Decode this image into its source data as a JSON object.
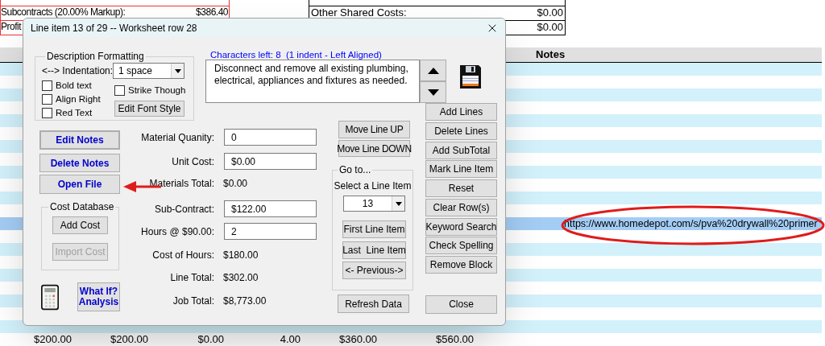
{
  "sheet": {
    "summary_left": [
      {
        "label": "Subcontracts (20.00% Markup):",
        "value": "$386.40"
      },
      {
        "label": "Profit"
      }
    ],
    "summary_right": [
      {
        "label": "Other Shared Costs:",
        "value": "$0.00"
      },
      {
        "value": "$0.00"
      }
    ],
    "notes_header": "Notes",
    "rows": [
      {
        "selected": false
      },
      {
        "selected": false
      },
      {
        "selected": false
      },
      {
        "selected": false
      },
      {
        "selected": false
      },
      {
        "selected": false
      },
      {
        "selected": false
      },
      {
        "selected": false
      },
      {
        "selected": false
      },
      {
        "selected": false
      },
      {
        "selected": false
      },
      {
        "selected": false
      },
      {
        "selected": true,
        "notes": "https://www.homedepot.com/s/pva%20drywall%20primer"
      },
      {
        "selected": false
      },
      {
        "selected": false
      },
      {
        "selected": false
      },
      {
        "selected": false
      },
      {
        "selected": false
      },
      {
        "selected": false
      },
      {
        "selected": false
      },
      {
        "selected": false
      },
      {
        "selected": false,
        "cells": [
          "$200.00",
          "$200.00",
          "$0.00",
          "4.00",
          "$360.00",
          "$560.00"
        ]
      }
    ]
  },
  "dialog": {
    "title": "Line item 13 of 29 -- Worksheet row 28",
    "characters_left": "Characters left: 8  (1 indent - Left Aligned)",
    "description": "Disconnect and remove all existing plumbing, electrical, appliances and fixtures as needed.",
    "formatting": {
      "title": "Description Formatting",
      "indentation_label": "<--> Indentation:",
      "indentation": "1 space",
      "options": [
        {
          "label": "Bold text",
          "checked": false
        },
        {
          "label": "Align Right",
          "checked": false
        },
        {
          "label": "Red Text",
          "checked": false
        },
        {
          "label": "Strike Though",
          "checked": false
        }
      ],
      "font_button": "Edit Font Style"
    },
    "notes_buttons": [
      {
        "label": "Edit Notes",
        "default": true
      },
      {
        "label": "Delete Notes",
        "default": false
      },
      {
        "label": "Open File",
        "default": false
      }
    ],
    "cost_database": {
      "title": "Cost Database",
      "buttons": [
        {
          "label": "Add Cost",
          "disabled": false
        },
        {
          "label": "Import Cost",
          "disabled": true
        }
      ]
    },
    "what_if": [
      "What If?",
      "Analysis"
    ],
    "form": [
      {
        "kind": "field",
        "label": "Material Quanity:",
        "value": "0"
      },
      {
        "kind": "field",
        "label": "Unit Cost:",
        "value": "$0.00"
      },
      {
        "kind": "readout",
        "label": "Materials Total:",
        "value": "$0.00"
      },
      {
        "kind": "field",
        "label": "Sub-Contract:",
        "value": "$122.00"
      },
      {
        "kind": "field",
        "label": "Hours @ $90.00:",
        "value": "2"
      },
      {
        "kind": "readout",
        "label": "Cost of Hours:",
        "value": "$180.00"
      },
      {
        "kind": "readout",
        "label": "Line Total:",
        "value": "$302.00"
      },
      {
        "kind": "readout",
        "label": "Job Total:",
        "value": "$8,773.00"
      }
    ],
    "move_buttons": [
      "Move Line UP",
      "Move Line DOWN"
    ],
    "goto": {
      "title": "Go to...",
      "label": "Select a Line Item",
      "value": "13",
      "buttons": [
        "First Line Item",
        "Last  Line Item",
        "<- Previous->"
      ]
    },
    "actions": [
      "Add Lines",
      "Delete Lines",
      "Add SubTotal",
      "Mark Line Item",
      "Reset",
      "Clear Row(s)",
      "Keyword Search",
      "Check Spelling",
      "Remove Block"
    ],
    "refresh": "Refresh Data",
    "close": "Close"
  }
}
